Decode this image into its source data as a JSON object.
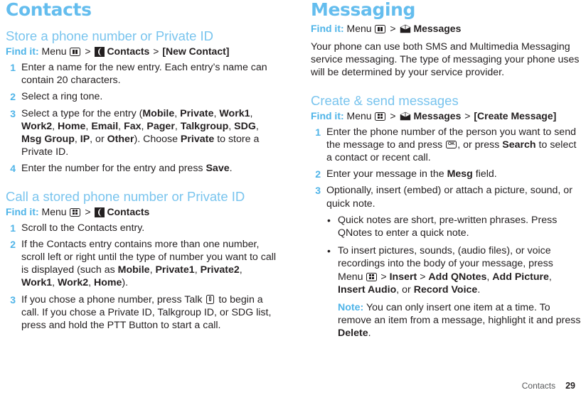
{
  "colors": {
    "heading_blue": "#64bdee",
    "section_blue": "#79c4ee",
    "accent_blue": "#4fb4e8",
    "body_black": "#231f20",
    "footer_gray": "#58595b"
  },
  "left_column": {
    "chapter_title": "Contacts",
    "sections": [
      {
        "heading": "Store a phone number or Private ID",
        "findit": {
          "label": "Find it:",
          "menu_word": "Menu",
          "menu_icon": "menu-key-icon",
          "sep1": ">",
          "app_icon": "contacts-icon",
          "app_label": "Contacts",
          "sep2": ">",
          "target": "[New Contact]"
        },
        "steps": [
          {
            "num": "1",
            "parts": [
              {
                "t": "Enter a name for the new entry. Each entry’s name can contain 20 characters.",
                "b": false
              }
            ]
          },
          {
            "num": "2",
            "parts": [
              {
                "t": "Select a ring tone.",
                "b": false
              }
            ]
          },
          {
            "num": "3",
            "parts": [
              {
                "t": "Select a type for the entry (",
                "b": false
              },
              {
                "t": "Mobile",
                "b": true
              },
              {
                "t": ", ",
                "b": false
              },
              {
                "t": "Private",
                "b": true
              },
              {
                "t": ", ",
                "b": false
              },
              {
                "t": "Work1",
                "b": true
              },
              {
                "t": ", ",
                "b": false
              },
              {
                "t": "Work2",
                "b": true
              },
              {
                "t": ", ",
                "b": false
              },
              {
                "t": "Home",
                "b": true
              },
              {
                "t": ", ",
                "b": false
              },
              {
                "t": "Email",
                "b": true
              },
              {
                "t": ", ",
                "b": false
              },
              {
                "t": "Fax",
                "b": true
              },
              {
                "t": ", ",
                "b": false
              },
              {
                "t": "Pager",
                "b": true
              },
              {
                "t": ", ",
                "b": false
              },
              {
                "t": "Talkgroup",
                "b": true
              },
              {
                "t": ", ",
                "b": false
              },
              {
                "t": "SDG",
                "b": true
              },
              {
                "t": ", ",
                "b": false
              },
              {
                "t": "Msg Group",
                "b": true
              },
              {
                "t": ", ",
                "b": false
              },
              {
                "t": "IP",
                "b": true
              },
              {
                "t": ", or ",
                "b": false
              },
              {
                "t": "Other",
                "b": true
              },
              {
                "t": "). Choose ",
                "b": false
              },
              {
                "t": "Private",
                "b": true
              },
              {
                "t": " to store a Private ID.",
                "b": false
              }
            ]
          },
          {
            "num": "4",
            "parts": [
              {
                "t": "Enter the number for the entry and press ",
                "b": false
              },
              {
                "t": "Save",
                "b": true
              },
              {
                "t": ".",
                "b": false
              }
            ]
          }
        ]
      },
      {
        "heading": "Call a stored phone number or Private ID",
        "findit": {
          "label": "Find it:",
          "menu_word": "Menu",
          "menu_icon": "menu-key-icon",
          "sep1": ">",
          "app_icon": "contacts-icon",
          "app_label": "Contacts",
          "sep2": "",
          "target": ""
        },
        "steps": [
          {
            "num": "1",
            "parts": [
              {
                "t": "Scroll to the Contacts entry.",
                "b": false
              }
            ]
          },
          {
            "num": "2",
            "parts": [
              {
                "t": "If the Contacts entry contains more than one number, scroll left or right until the type of number you want to call is displayed (such as ",
                "b": false
              },
              {
                "t": "Mobile",
                "b": true
              },
              {
                "t": ", ",
                "b": false
              },
              {
                "t": "Private1",
                "b": true
              },
              {
                "t": ", ",
                "b": false
              },
              {
                "t": "Private2",
                "b": true
              },
              {
                "t": ", ",
                "b": false
              },
              {
                "t": "Work1",
                "b": true
              },
              {
                "t": ", ",
                "b": false
              },
              {
                "t": "Work2",
                "b": true
              },
              {
                "t": ", ",
                "b": false
              },
              {
                "t": "Home",
                "b": true
              },
              {
                "t": ").",
                "b": false
              }
            ]
          },
          {
            "num": "3",
            "parts": [
              {
                "t": "If you chose a phone number, press Talk ",
                "b": false
              },
              {
                "icon": "talk-key-icon"
              },
              {
                "t": " to begin a call. If you chose a Private ID, Talkgroup ID, or SDG list, press and hold the PTT Button to start a call.",
                "b": false
              }
            ]
          }
        ]
      }
    ]
  },
  "right_column": {
    "chapter_title": "Messaging",
    "intro_findit": {
      "label": "Find it:",
      "menu_word": "Menu",
      "menu_icon": "menu-key-icon",
      "sep1": ">",
      "app_icon": "messages-icon",
      "app_label": "Messages",
      "sep2": "",
      "target": ""
    },
    "intro_paragraph": "Your phone can use both SMS and Multimedia Messaging service messaging. The type of messaging your phone uses will be determined by your service provider.",
    "section": {
      "heading": "Create & send messages",
      "findit": {
        "label": "Find it:",
        "menu_word": "Menu",
        "menu_icon": "menu-key-icon",
        "sep1": ">",
        "app_icon": "messages-icon",
        "app_label": "Messages",
        "sep2": ">",
        "target": "[Create Message]"
      },
      "steps": [
        {
          "num": "1",
          "parts": [
            {
              "t": "Enter the phone number of the person you want to send the message to and press ",
              "b": false
            },
            {
              "icon": "ok-key-icon"
            },
            {
              "t": ", or press ",
              "b": false
            },
            {
              "t": "Search",
              "b": true
            },
            {
              "t": " to select a contact or recent call.",
              "b": false
            }
          ]
        },
        {
          "num": "2",
          "parts": [
            {
              "t": "Enter your message in the ",
              "b": false
            },
            {
              "t": "Mesg",
              "b": true
            },
            {
              "t": " field.",
              "b": false
            }
          ]
        },
        {
          "num": "3",
          "parts": [
            {
              "t": "Optionally, insert (embed) or attach a picture, sound, or quick note.",
              "b": false
            }
          ],
          "bullets": [
            {
              "parts": [
                {
                  "t": "Quick notes are short, pre-written phrases. Press QNotes to enter a quick note.",
                  "b": false
                }
              ]
            },
            {
              "parts": [
                {
                  "t": "To insert pictures, sounds, (audio files), or voice recordings into the body of your message, press Menu ",
                  "b": false
                },
                {
                  "icon": "menu-key-icon"
                },
                {
                  "t": " > ",
                  "b": false
                },
                {
                  "t": "Insert",
                  "b": true
                },
                {
                  "t": " > ",
                  "b": false
                },
                {
                  "t": "Add QNotes",
                  "b": true
                },
                {
                  "t": ", ",
                  "b": false
                },
                {
                  "t": "Add Picture",
                  "b": true
                },
                {
                  "t": ", ",
                  "b": false
                },
                {
                  "t": "Insert Audio",
                  "b": true
                },
                {
                  "t": ", or ",
                  "b": false
                },
                {
                  "t": "Record Voice",
                  "b": true
                },
                {
                  "t": ".",
                  "b": false
                }
              ],
              "note": {
                "label": "Note:",
                "parts": [
                  {
                    "t": " You can only insert one item at a time. To remove an item from a message, highlight it and press ",
                    "b": false
                  },
                  {
                    "t": "Delete",
                    "b": true
                  },
                  {
                    "t": ".",
                    "b": false
                  }
                ]
              }
            }
          ]
        }
      ]
    }
  },
  "footer": {
    "chapter_name": "Contacts",
    "page_number": "29"
  }
}
